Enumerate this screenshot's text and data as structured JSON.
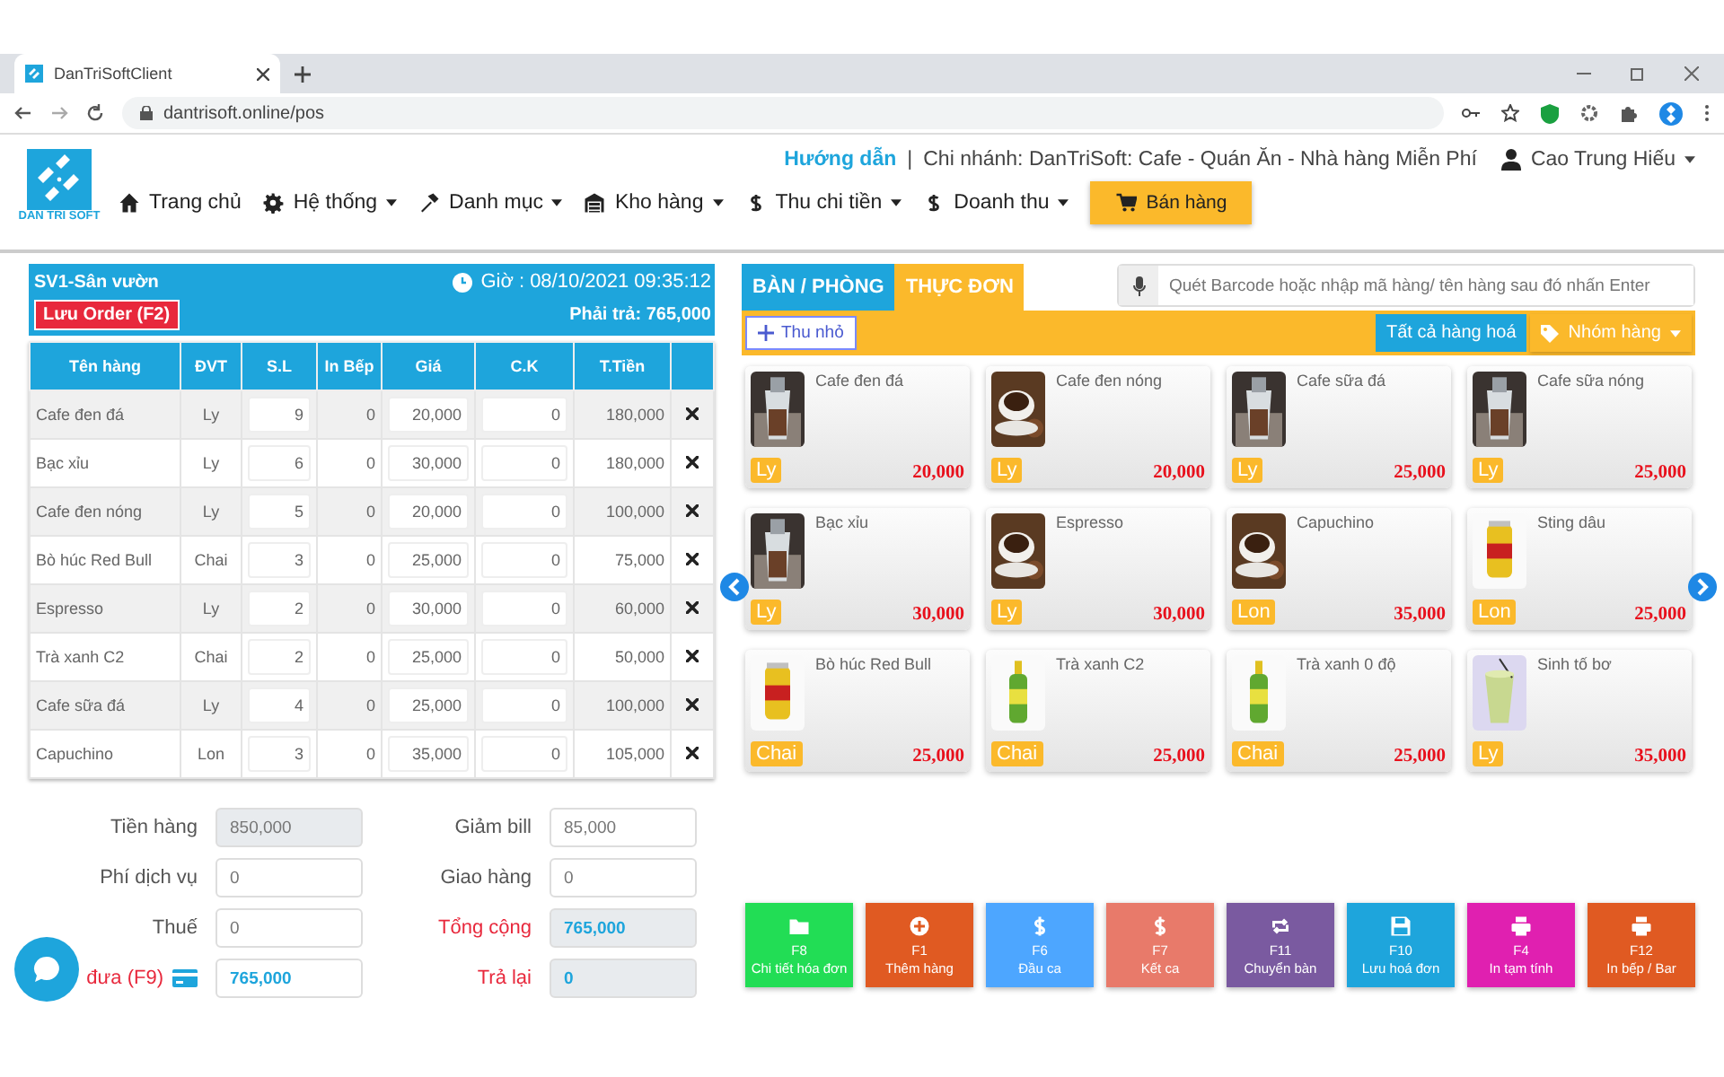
{
  "browser": {
    "tab_title": "DanTriSoftClient",
    "url": "dantrisoft.online/pos"
  },
  "header": {
    "logo_text": "DAN TRI SOFT",
    "help_link": "Hướng dẫn",
    "separator": "|",
    "branch": "Chi nhánh: DanTriSoft: Cafe - Quán Ăn - Nhà hàng Miễn Phí",
    "user": "Cao Trung Hiếu",
    "nav": [
      {
        "label": "Trang chủ",
        "kind": "home",
        "dropdown": false,
        "selected": false
      },
      {
        "label": "Hệ thống",
        "kind": "gear",
        "dropdown": true,
        "selected": false
      },
      {
        "label": "Danh mục",
        "kind": "hammer",
        "dropdown": true,
        "selected": false
      },
      {
        "label": "Kho hàng",
        "kind": "warehouse",
        "dropdown": true,
        "selected": false
      },
      {
        "label": "Thu chi tiền",
        "kind": "dollar",
        "dropdown": true,
        "selected": false
      },
      {
        "label": "Doanh thu",
        "kind": "dollar",
        "dropdown": true,
        "selected": false
      },
      {
        "label": "Bán hàng",
        "kind": "cart",
        "dropdown": false,
        "selected": true
      }
    ]
  },
  "order": {
    "table_name": "SV1-Sân vườn",
    "time": "Giờ : 08/10/2021 09:35:12",
    "save_button": "Lưu Order (F2)",
    "to_pay": "Phải trả: 765,000",
    "columns": [
      "Tên hàng",
      "ĐVT",
      "S.L",
      "In Bếp",
      "Giá",
      "C.K",
      "T.Tiền"
    ],
    "rows": [
      {
        "name": "Cafe đen đá",
        "unit": "Ly",
        "qty": "9",
        "kitchen": "0",
        "price": "20,000",
        "discount": "0",
        "total": "180,000"
      },
      {
        "name": "Bạc xỉu",
        "unit": "Ly",
        "qty": "6",
        "kitchen": "0",
        "price": "30,000",
        "discount": "0",
        "total": "180,000"
      },
      {
        "name": "Cafe đen nóng",
        "unit": "Ly",
        "qty": "5",
        "kitchen": "0",
        "price": "20,000",
        "discount": "0",
        "total": "100,000"
      },
      {
        "name": "Bò húc Red Bull",
        "unit": "Chai",
        "qty": "3",
        "kitchen": "0",
        "price": "25,000",
        "discount": "0",
        "total": "75,000"
      },
      {
        "name": "Espresso",
        "unit": "Ly",
        "qty": "2",
        "kitchen": "0",
        "price": "30,000",
        "discount": "0",
        "total": "60,000"
      },
      {
        "name": "Trà xanh C2",
        "unit": "Chai",
        "qty": "2",
        "kitchen": "0",
        "price": "25,000",
        "discount": "0",
        "total": "50,000"
      },
      {
        "name": "Cafe sữa đá",
        "unit": "Ly",
        "qty": "4",
        "kitchen": "0",
        "price": "25,000",
        "discount": "0",
        "total": "100,000"
      },
      {
        "name": "Capuchino",
        "unit": "Lon",
        "qty": "3",
        "kitchen": "0",
        "price": "35,000",
        "discount": "0",
        "total": "105,000"
      }
    ]
  },
  "summary": {
    "left": [
      {
        "label": "Tiền hàng",
        "value": "850,000",
        "readonly": true,
        "highlight": false
      },
      {
        "label": "Phí dịch vụ",
        "value": "0",
        "readonly": false,
        "highlight": false
      },
      {
        "label": "Thuế",
        "value": "0",
        "readonly": false,
        "highlight": false
      },
      {
        "label": "đưa (F9)",
        "value": "765,000",
        "readonly": false,
        "highlight": true
      }
    ],
    "right": [
      {
        "label": "Giảm bill",
        "value": "85,000",
        "readonly": false,
        "highlight": false
      },
      {
        "label": "Giao hàng",
        "value": "0",
        "readonly": false,
        "highlight": false
      },
      {
        "label": "Tổng cộng",
        "value": "765,000",
        "readonly": true,
        "highlight": true
      },
      {
        "label": "Trả lại",
        "value": "0",
        "readonly": true,
        "highlight": true
      }
    ]
  },
  "menu": {
    "tabs": [
      {
        "label": "BÀN / PHÒNG",
        "selected": false
      },
      {
        "label": "THỰC ĐƠN",
        "selected": true
      }
    ],
    "search": {
      "placeholder": "Quét Barcode hoặc nhập mã hàng/ tên hàng sau đó nhấn Enter"
    },
    "collapse_button": "Thu nhỏ",
    "all_button": "Tất cả hàng hoá",
    "group_button": "Nhóm hàng",
    "products": [
      {
        "name": "Cafe đen đá",
        "unit": "Ly",
        "price": "20,000",
        "kind": "glass"
      },
      {
        "name": "Cafe đen nóng",
        "unit": "Ly",
        "price": "20,000",
        "kind": "cup"
      },
      {
        "name": "Cafe sữa đá",
        "unit": "Ly",
        "price": "25,000",
        "kind": "glass"
      },
      {
        "name": "Cafe sữa nóng",
        "unit": "Ly",
        "price": "25,000",
        "kind": "glass"
      },
      {
        "name": "Bạc xỉu",
        "unit": "Ly",
        "price": "30,000",
        "kind": "glass"
      },
      {
        "name": "Espresso",
        "unit": "Ly",
        "price": "30,000",
        "kind": "cup"
      },
      {
        "name": "Capuchino",
        "unit": "Lon",
        "price": "35,000",
        "kind": "cup"
      },
      {
        "name": "Sting dâu",
        "unit": "Lon",
        "price": "25,000",
        "kind": "can"
      },
      {
        "name": "Bò húc Red Bull",
        "unit": "Chai",
        "price": "25,000",
        "kind": "can"
      },
      {
        "name": "Trà xanh C2",
        "unit": "Chai",
        "price": "25,000",
        "kind": "bottle"
      },
      {
        "name": "Trà xanh 0 độ",
        "unit": "Chai",
        "price": "25,000",
        "kind": "bottle"
      },
      {
        "name": "Sinh tố bơ",
        "unit": "Ly",
        "price": "35,000",
        "kind": "smoothie"
      }
    ]
  },
  "actions": [
    {
      "key": "F8",
      "label": "Chi tiết hóa đơn",
      "color": "#22dd55",
      "kind": "folder"
    },
    {
      "key": "F1",
      "label": "Thêm hàng",
      "color": "#e05a22",
      "kind": "plus"
    },
    {
      "key": "F6",
      "label": "Đầu ca",
      "color": "#4da6ff",
      "kind": "dollar"
    },
    {
      "key": "F7",
      "label": "Kết ca",
      "color": "#e87a6a",
      "kind": "dollar"
    },
    {
      "key": "F11",
      "label": "Chuyển bàn",
      "color": "#7a5aa0",
      "kind": "swap"
    },
    {
      "key": "F10",
      "label": "Lưu hoá đơn",
      "color": "#1ea5dc",
      "kind": "save"
    },
    {
      "key": "F4",
      "label": "In tạm tính",
      "color": "#e020b0",
      "kind": "print"
    },
    {
      "key": "F12",
      "label": "In bếp / Bar",
      "color": "#e05a22",
      "kind": "print"
    }
  ]
}
